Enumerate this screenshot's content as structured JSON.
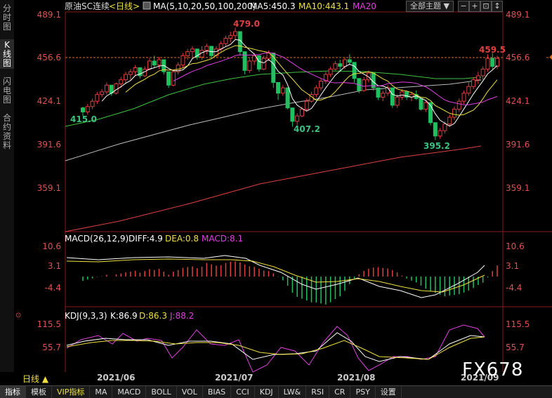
{
  "sidebar": {
    "tabs": [
      {
        "label": "分时图",
        "active": false
      },
      {
        "label": "K线图",
        "active": true
      },
      {
        "label": "闪电图",
        "active": false
      },
      {
        "label": "合约资料",
        "active": false
      }
    ]
  },
  "header": {
    "symbol": "原油SC连续",
    "period": "<日线>",
    "ma_legend": "MA(5,10,20,50,100,200)",
    "ma5": "MA5:450.3",
    "ma10": "MA10:443.1",
    "ma20": "MA20",
    "theme_select": "全部主题",
    "colors": {
      "ma5": "#ffffff",
      "ma10": "#f0e040",
      "ma20": "#e040e0"
    }
  },
  "price_axis": [
    "489.1",
    "456.6",
    "424.1",
    "391.6",
    "359.1"
  ],
  "current_price": "456.6",
  "annotations": {
    "high": "479.0",
    "low1": "415.0",
    "low2": "407.2",
    "low3": "395.2",
    "recent_high": "459.5"
  },
  "macd": {
    "label": "MACD(26,12,9)",
    "diff": "DIFF:4.9",
    "dea": "DEA:0.8",
    "macd": "MACD:8.1",
    "ticks": [
      "10.6",
      "3.1",
      "-4.4"
    ]
  },
  "kdj": {
    "label": "KDJ(9,3,3)",
    "k": "K:86.9",
    "d": "D:86.3",
    "j": "J:88.2",
    "ticks": [
      "115.5",
      "55.7"
    ]
  },
  "x_labels": [
    "2021/06",
    "2021/07",
    "2021/08",
    "2021/09"
  ],
  "period_tab": "日线 ▲",
  "watermark": "FX678",
  "bottom_tabs": [
    "指标",
    "模板",
    "VIP指标",
    "MA",
    "MACD",
    "BOLL",
    "VOL",
    "BIAS",
    "CCI",
    "KDJ",
    "LW&",
    "RSI",
    "CR",
    "PSY",
    "设置"
  ],
  "chart_data": {
    "type": "candlestick",
    "candles": [
      [
        419,
        420,
        413,
        416
      ],
      [
        416,
        422,
        414,
        420
      ],
      [
        420,
        426,
        418,
        424
      ],
      [
        424,
        431,
        422,
        429
      ],
      [
        429,
        433,
        427,
        431
      ],
      [
        431,
        438,
        429,
        436
      ],
      [
        436,
        434,
        428,
        430
      ],
      [
        430,
        438,
        429,
        437
      ],
      [
        437,
        442,
        434,
        440
      ],
      [
        440,
        446,
        437,
        444
      ],
      [
        444,
        448,
        440,
        446
      ],
      [
        446,
        451,
        443,
        449
      ],
      [
        449,
        446,
        441,
        443
      ],
      [
        443,
        450,
        442,
        448
      ],
      [
        448,
        456,
        447,
        454
      ],
      [
        454,
        458,
        449,
        451
      ],
      [
        451,
        457,
        448,
        455
      ],
      [
        455,
        452,
        444,
        446
      ],
      [
        446,
        441,
        434,
        436
      ],
      [
        436,
        447,
        435,
        446
      ],
      [
        446,
        453,
        444,
        451
      ],
      [
        451,
        460,
        449,
        458
      ],
      [
        458,
        463,
        455,
        461
      ],
      [
        461,
        465,
        457,
        463
      ],
      [
        463,
        460,
        455,
        457
      ],
      [
        457,
        465,
        455,
        462
      ],
      [
        462,
        467,
        459,
        465
      ],
      [
        465,
        461,
        456,
        458
      ],
      [
        458,
        465,
        457,
        463
      ],
      [
        463,
        469,
        461,
        467
      ],
      [
        467,
        473,
        465,
        471
      ],
      [
        471,
        476,
        468,
        473
      ],
      [
        473,
        479,
        470,
        476
      ],
      [
        476,
        469,
        458,
        461
      ],
      [
        461,
        452,
        444,
        447
      ],
      [
        447,
        456,
        445,
        454
      ],
      [
        454,
        460,
        451,
        458
      ],
      [
        458,
        452,
        446,
        448
      ],
      [
        448,
        458,
        447,
        456
      ],
      [
        456,
        462,
        454,
        460
      ],
      [
        460,
        445,
        434,
        438
      ],
      [
        438,
        433,
        425,
        430
      ],
      [
        430,
        436,
        428,
        434
      ],
      [
        434,
        422,
        418,
        419
      ],
      [
        419,
        411,
        405,
        409
      ],
      [
        409,
        415,
        406,
        413
      ],
      [
        413,
        420,
        412,
        418
      ],
      [
        418,
        426,
        417,
        424
      ],
      [
        424,
        431,
        423,
        429
      ],
      [
        429,
        436,
        427,
        434
      ],
      [
        434,
        441,
        432,
        439
      ],
      [
        439,
        446,
        437,
        444
      ],
      [
        444,
        450,
        442,
        448
      ],
      [
        448,
        454,
        447,
        452
      ],
      [
        452,
        455,
        446,
        450
      ],
      [
        450,
        457,
        448,
        455
      ],
      [
        455,
        459,
        451,
        453
      ],
      [
        453,
        448,
        438,
        441
      ],
      [
        441,
        436,
        430,
        432
      ],
      [
        432,
        442,
        431,
        440
      ],
      [
        440,
        447,
        438,
        445
      ],
      [
        445,
        439,
        432,
        434
      ],
      [
        434,
        429,
        425,
        427
      ],
      [
        427,
        432,
        424,
        430
      ],
      [
        430,
        436,
        428,
        434
      ],
      [
        434,
        422,
        419,
        421
      ],
      [
        421,
        429,
        419,
        427
      ],
      [
        427,
        433,
        425,
        431
      ],
      [
        431,
        429,
        425,
        427
      ],
      [
        427,
        431,
        424,
        429
      ],
      [
        429,
        432,
        425,
        426
      ],
      [
        426,
        420,
        417,
        418
      ],
      [
        418,
        425,
        416,
        423
      ],
      [
        423,
        415,
        406,
        408
      ],
      [
        408,
        400,
        395,
        398
      ],
      [
        398,
        404,
        396,
        402
      ],
      [
        402,
        409,
        400,
        407
      ],
      [
        407,
        414,
        405,
        412
      ],
      [
        412,
        420,
        410,
        418
      ],
      [
        418,
        426,
        416,
        424
      ],
      [
        424,
        432,
        422,
        430
      ],
      [
        430,
        438,
        428,
        435
      ],
      [
        435,
        442,
        433,
        440
      ],
      [
        440,
        446,
        437,
        443
      ],
      [
        443,
        450,
        440,
        448
      ],
      [
        448,
        459,
        446,
        456
      ],
      [
        456,
        460,
        448,
        450
      ],
      [
        450,
        458,
        448,
        456
      ]
    ],
    "ylim": [
      340,
      494
    ],
    "y_ticks": [
      489.1,
      456.6,
      424.1,
      391.6,
      359.1
    ]
  }
}
